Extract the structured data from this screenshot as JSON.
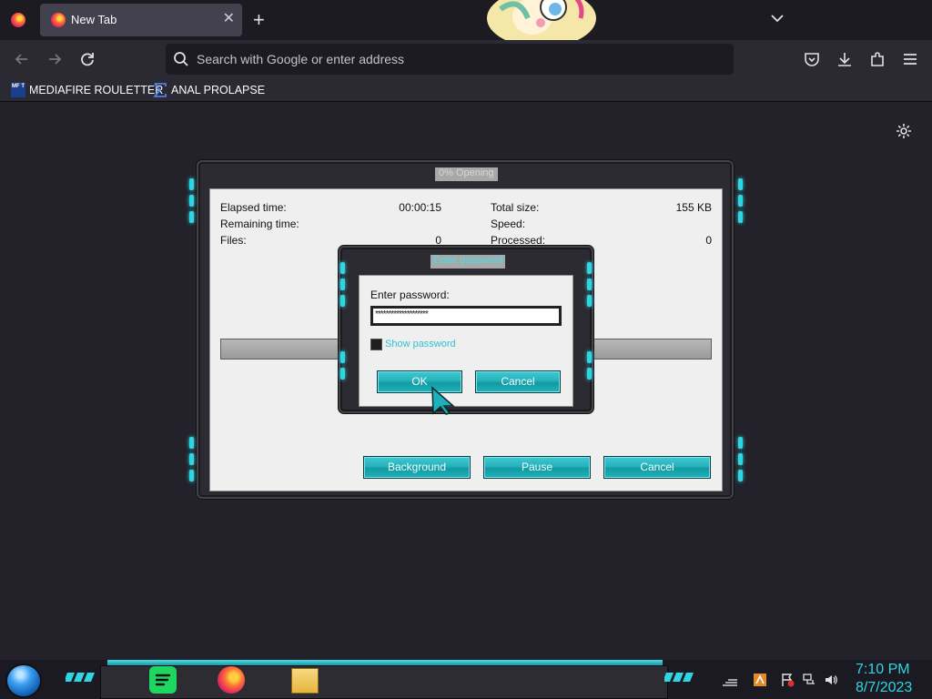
{
  "browser": {
    "tab": {
      "title": "New Tab",
      "close_glyph": "✕"
    },
    "new_tab_glyph": "+",
    "url_placeholder": "Search with Google or enter address",
    "bookmarks": [
      {
        "label": "MEDIAFIRE ROULETTER",
        "icon": "mediafire-icon",
        "icon_text": "MF T"
      },
      {
        "label": "ANAL PROLAPSE",
        "icon": "sigma-icon"
      }
    ]
  },
  "extract_dialog": {
    "title": "0% Opening",
    "stats_left": [
      {
        "label": "Elapsed time:",
        "value": "00:00:15"
      },
      {
        "label": "Remaining time:",
        "value": ""
      },
      {
        "label": "Files:",
        "value": "0"
      }
    ],
    "stats_right": [
      {
        "label": "Total size:",
        "value": "155 KB"
      },
      {
        "label": "Speed:",
        "value": ""
      },
      {
        "label": "Processed:",
        "value": "0"
      }
    ],
    "progress": 0,
    "buttons": {
      "background": "Background",
      "pause": "Pause",
      "cancel": "Cancel"
    }
  },
  "password_dialog": {
    "title": "Enter password",
    "prompt": "Enter password:",
    "masked_value": "********************",
    "show_password_label": "Show password",
    "show_password_checked": false,
    "buttons": {
      "ok": "OK",
      "cancel": "Cancel"
    }
  },
  "taskbar": {
    "time": "7:10 PM",
    "date": "8/7/2023",
    "apps": [
      "spotify-icon",
      "firefox-icon",
      "file-explorer-icon"
    ],
    "tray_icons": [
      "network-bars-icon",
      "app-tray-icon",
      "action-center-flag-icon",
      "network-icon",
      "volume-icon"
    ]
  },
  "colors": {
    "accent_cyan": "#2fd6e2",
    "button_teal": "#1fb1ba",
    "chrome_dark": "#1c1b22"
  }
}
